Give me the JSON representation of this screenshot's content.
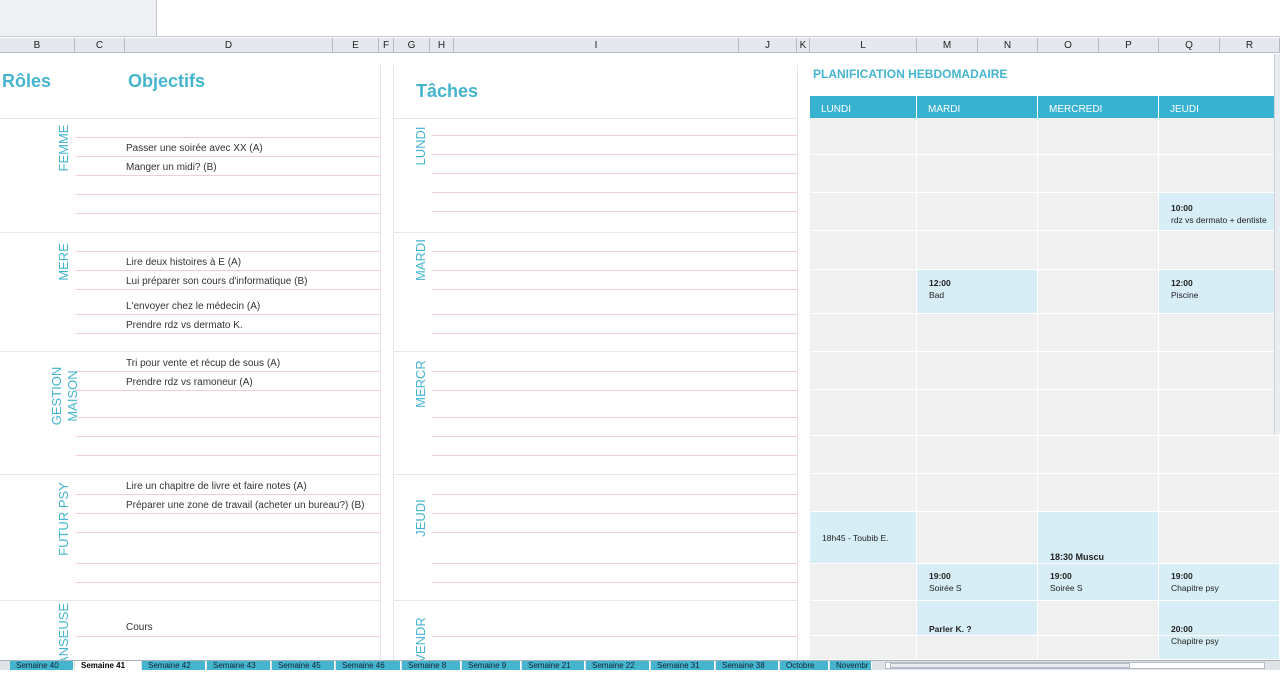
{
  "columns": [
    "B",
    "C",
    "D",
    "E",
    "F",
    "G",
    "H",
    "I",
    "J",
    "K",
    "L",
    "M",
    "N",
    "O",
    "P",
    "Q",
    "R"
  ],
  "left": {
    "roles_title": "Rôles",
    "objectives_title": "Objectifs",
    "tasks_title": "Tâches",
    "roles": [
      "FEMME",
      "MERE",
      "GESTION MAISON",
      "FUTUR PSY",
      "ANSEUSE"
    ],
    "goals": [
      "Passer une soirée avec XX (A)",
      "Manger un midi? (B)",
      "Lire deux histoires à E (A)",
      "Lui préparer son cours d'informatique (B)",
      "L'envoyer chez le médecin (A)",
      "Prendre rdz vs dermato K.",
      "Tri pour vente et récup de sous (A)",
      "Prendre rdz vs ramoneur (A)",
      "Lire un chapitre de livre et faire notes (A)",
      "Préparer une zone de travail (acheter un bureau?) (B)",
      "Cours"
    ],
    "days": [
      "LUNDI",
      "MARDI",
      "MERCR",
      "JEUDI",
      "VENDR"
    ]
  },
  "planning": {
    "title": "PLANIFICATION HEBDOMADAIRE",
    "days": [
      "LUNDI",
      "MARDI",
      "MERCREDI",
      "JEUDI"
    ],
    "events": [
      {
        "time": "10:00",
        "text": "rdz vs dermato + dentiste"
      },
      {
        "time": "12:00",
        "text": "Bad"
      },
      {
        "time": "12:00",
        "text": "Piscine"
      },
      {
        "time": "",
        "text": "18h45 - Toubib E."
      },
      {
        "time": "18:30 Muscu",
        "text": ""
      },
      {
        "time": "19:00",
        "text": "Soirée S"
      },
      {
        "time": "19:00",
        "text": "Soirée S"
      },
      {
        "time": "19:00",
        "text": "Chapitre psy"
      },
      {
        "time": "Parler K. ?",
        "text": ""
      },
      {
        "time": "20:00",
        "text": "Chapitre psy"
      }
    ]
  },
  "sheet_tabs": [
    "Semaine 40",
    "Semaine 41",
    "Semaine 42",
    "Semaine 43",
    "Semaine 45",
    "Semaine 46",
    "Semaine 8",
    "Semaine 9",
    "Semaine 21",
    "Semaine 22",
    "Semaine 31",
    "Semaine 38",
    "Octobre",
    "Novembr"
  ],
  "colors": {
    "accent": "#45b5cf",
    "header_fill": "#39b1d1",
    "cell": "#f0f0f0",
    "highlight": "#d7eef7"
  }
}
